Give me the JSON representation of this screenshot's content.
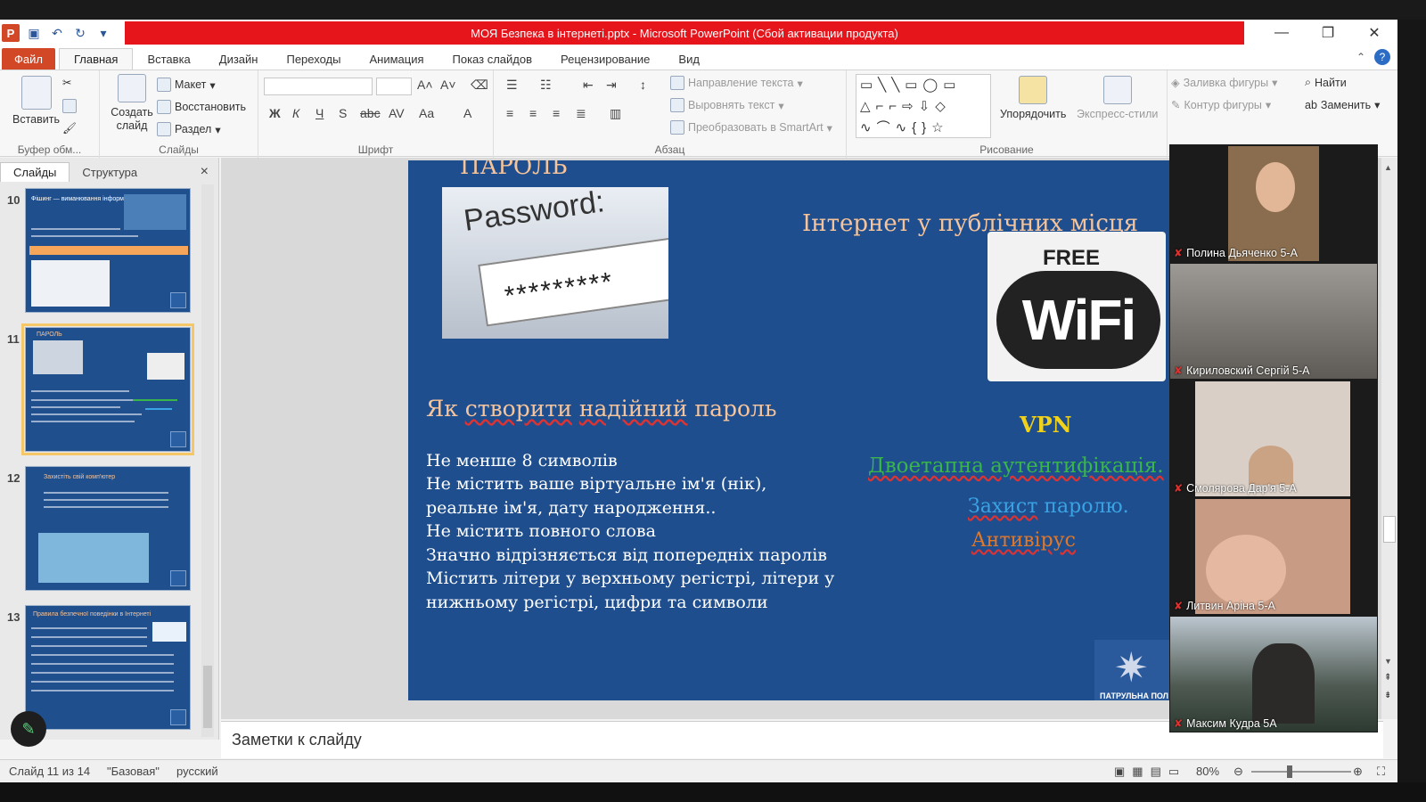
{
  "window": {
    "title": "МОЯ Безпека в інтернеті.pptx  -  Microsoft PowerPoint (Сбой активации продукта)",
    "title_bar_color": "#e6141b",
    "app_icon": "P",
    "controls": [
      "minimize-icon",
      "restore-icon",
      "close-icon"
    ]
  },
  "quick_access": [
    "save-icon",
    "undo-icon",
    "redo-icon",
    "customize-icon"
  ],
  "tabs": {
    "file": "Файл",
    "items": [
      "Главная",
      "Вставка",
      "Дизайн",
      "Переходы",
      "Анимация",
      "Показ слайдов",
      "Рецензирование",
      "Вид"
    ],
    "active": "Главная"
  },
  "ribbon": {
    "clipboard": {
      "paste": "Вставить",
      "label": "Буфер обм..."
    },
    "slides": {
      "new_slide": "Создать слайд",
      "layout": "Макет",
      "reset": "Восстановить",
      "section": "Раздел",
      "label": "Слайды"
    },
    "font": {
      "bold": "Ж",
      "italic": "К",
      "underline": "Ч",
      "strike": "S",
      "strike2": "abc",
      "spacing": "AV",
      "case": "Aa",
      "color": "A",
      "label": "Шрифт"
    },
    "paragraph": {
      "text_direction": "Направление текста",
      "align_text": "Выровнять текст",
      "smartart": "Преобразовать в SmartArt",
      "label": "Абзац"
    },
    "drawing": {
      "arrange": "Упорядочить",
      "quick_styles": "Экспресс-стили",
      "fill": "Заливка фигуры",
      "outline": "Контур фигуры",
      "label": "Рисование"
    },
    "editing": {
      "find": "Найти",
      "replace": "Заменить"
    }
  },
  "panel": {
    "tab_slides": "Слайды",
    "tab_outline": "Структура",
    "close": "×",
    "thumbs": [
      {
        "num": "10",
        "title": "Фішинг — виманювання інформації."
      },
      {
        "num": "11",
        "title": "ПАРОЛЬ",
        "selected": true
      },
      {
        "num": "12",
        "title": "Захистіть свій комп'ютер"
      },
      {
        "num": "13",
        "title": "Правила безпечної поведінки в Інтернеті"
      }
    ]
  },
  "slide": {
    "heading": "ПАРОЛЬ",
    "right_heading": "Інтернет у публічних місця",
    "image_password_word": "Password:",
    "image_password_stars": "*********",
    "wifi_free": "FREE",
    "wifi_text": "WiFi",
    "subheading": {
      "pre": "Як ",
      "w1": "створити",
      "w2": "надійний",
      "post": " пароль"
    },
    "body_lines": [
      "Не менше  8 символів",
      "Не містить  ваше віртуальне ім'я (нік),",
      "реальне ім'я,  дату народження..",
      "Не містить  повного слова",
      "Значно  відрізняється  від попередніх  паролів",
      "Містить  літери у верхньому  регістрі,  літери у",
      "нижньому  регістрі,  цифри та символи"
    ],
    "vpn": "VPN",
    "twofa": "Двоетапна аутентифікація.",
    "protect_a": "Захист",
    "protect_b": " паролю.",
    "antivirus": "Антивірус",
    "emblem_text": "ПАТРУЛЬНА ПОЛ",
    "colors": {
      "bg": "#1f4e8e",
      "heading": "#f6c49b",
      "vpn": "#f0d21c",
      "twofa": "#39b54a",
      "protect": "#3aa3e3",
      "antivirus": "#e0782a"
    }
  },
  "notes": {
    "placeholder": "Заметки к слайду"
  },
  "status": {
    "slide_info": "Слайд 11 из 14",
    "theme": "\"Базовая\"",
    "language": "русский",
    "zoom": "80%"
  },
  "video": {
    "participants": [
      {
        "name": "Полина Дьяченко 5-А",
        "muted": true
      },
      {
        "name": "Кириловский Сергій 5-А",
        "muted": true
      },
      {
        "name": "Смолярова Дар'я 5-А",
        "muted": true
      },
      {
        "name": "Литвин Аріна 5-А",
        "muted": true
      },
      {
        "name": "Максим Кудра 5А",
        "muted": true
      }
    ]
  }
}
